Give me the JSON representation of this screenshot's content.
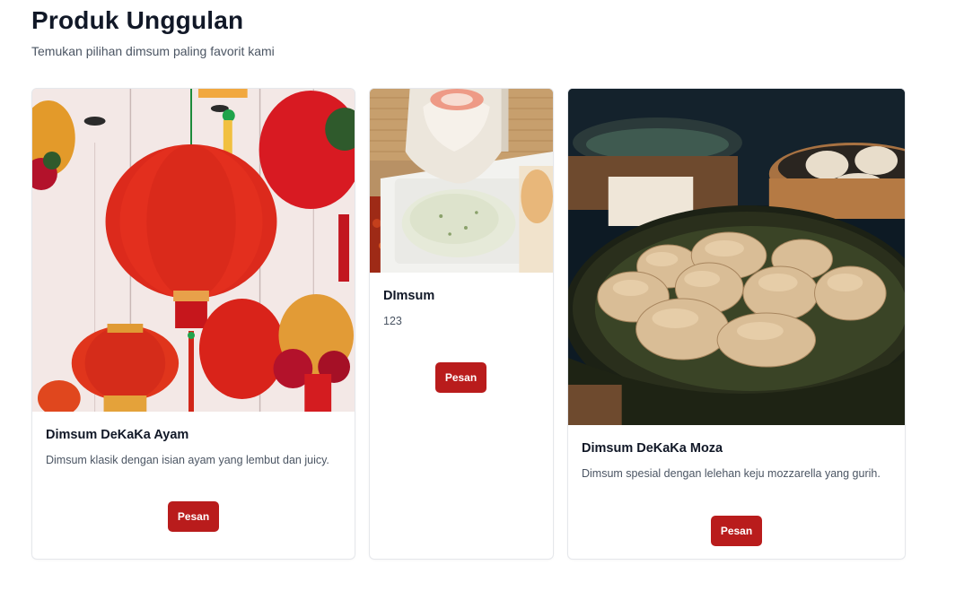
{
  "section": {
    "title": "Produk Unggulan",
    "subtitle": "Temukan pilihan dimsum paling favorit kami"
  },
  "products": [
    {
      "name": "Dimsum DeKaKa Ayam",
      "description": "Dimsum klasik dengan isian ayam yang lembut dan juicy.",
      "button_label": "Pesan",
      "image": "red-lanterns-photo"
    },
    {
      "name": "DImsum",
      "description": "123",
      "button_label": "Pesan",
      "image": "dumpling-with-sauce-photo"
    },
    {
      "name": "Dimsum DeKaKa Moza",
      "description": "Dimsum spesial dengan lelehan keju mozzarella yang gurih.",
      "button_label": "Pesan",
      "image": "steamed-dumplings-basket-photo"
    }
  ],
  "colors": {
    "accent": "#b91c1c",
    "title": "#111827",
    "muted": "#4b5563",
    "border": "#e5e7eb"
  }
}
